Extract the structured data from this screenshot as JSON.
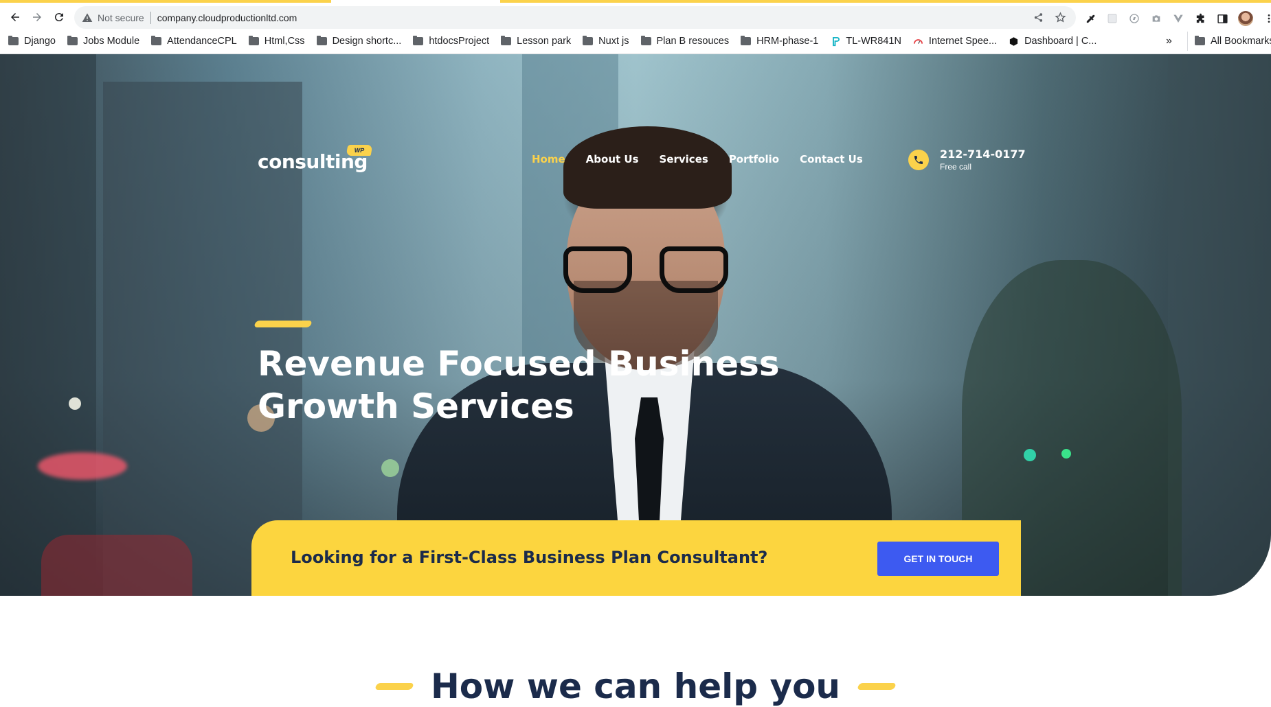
{
  "browser": {
    "security_label": "Not secure",
    "url": "company.cloudproductionltd.com",
    "bookmarks": [
      {
        "label": "Django",
        "icon": "folder-icon"
      },
      {
        "label": "Jobs Module",
        "icon": "folder-icon"
      },
      {
        "label": "AttendanceCPL",
        "icon": "folder-icon"
      },
      {
        "label": "Html,Css",
        "icon": "folder-icon"
      },
      {
        "label": "Design shortc...",
        "icon": "folder-icon"
      },
      {
        "label": "htdocsProject",
        "icon": "folder-icon"
      },
      {
        "label": "Lesson park",
        "icon": "folder-icon"
      },
      {
        "label": "Nuxt js",
        "icon": "folder-icon"
      },
      {
        "label": "Plan B resouces",
        "icon": "folder-icon"
      },
      {
        "label": "HRM-phase-1",
        "icon": "folder-icon"
      },
      {
        "label": "TL-WR841N",
        "icon": "tplink-icon"
      },
      {
        "label": "Internet Spee...",
        "icon": "speedometer-icon"
      },
      {
        "label": "Dashboard | C...",
        "icon": "hexagon-icon"
      }
    ],
    "more_label": "»",
    "all_bookmarks_label": "All Bookmarks"
  },
  "site": {
    "logo_text": "consulting",
    "logo_badge": "WP",
    "nav": [
      {
        "label": "Home",
        "active": true
      },
      {
        "label": "About Us",
        "active": false
      },
      {
        "label": "Services",
        "active": false
      },
      {
        "label": "Portfolio",
        "active": false
      },
      {
        "label": "Contact Us",
        "active": false
      }
    ],
    "phone": "212-714-0177",
    "phone_label": "Free call",
    "headline_line1": "Revenue Focused Business",
    "headline_line2": "Growth Services",
    "cta_text": "Looking for a First-Class Business Plan Consultant?",
    "cta_button": "GET IN TOUCH",
    "section_title": "How we can help you"
  },
  "colors": {
    "accent_yellow": "#fcd53f",
    "button_blue": "#3d5af1",
    "navy_text": "#1b2b4b"
  }
}
